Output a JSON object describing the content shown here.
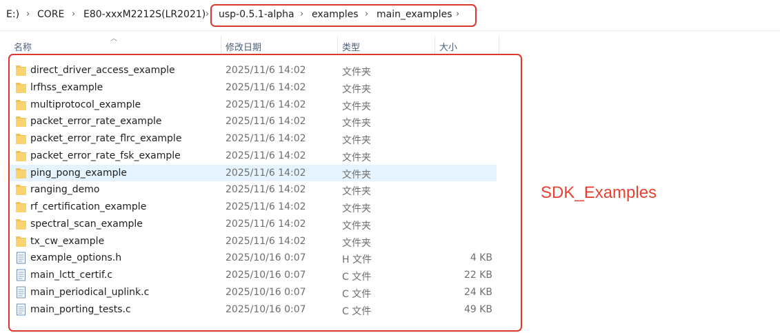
{
  "breadcrumb": {
    "drive": "E:)",
    "items": [
      "CORE",
      "E80-xxxM2212S(LR2021)",
      "usp-0.5.1-alpha",
      "examples",
      "main_examples"
    ]
  },
  "columns": {
    "name": "名称",
    "modified": "修改日期",
    "type": "类型",
    "size": "大小"
  },
  "files": [
    {
      "name": "direct_driver_access_example",
      "modified": "2025/11/6 14:02",
      "type": "文件夹",
      "size": "",
      "icon": "folder"
    },
    {
      "name": "lrfhss_example",
      "modified": "2025/11/6 14:02",
      "type": "文件夹",
      "size": "",
      "icon": "folder"
    },
    {
      "name": "multiprotocol_example",
      "modified": "2025/11/6 14:02",
      "type": "文件夹",
      "size": "",
      "icon": "folder"
    },
    {
      "name": "packet_error_rate_example",
      "modified": "2025/11/6 14:02",
      "type": "文件夹",
      "size": "",
      "icon": "folder"
    },
    {
      "name": "packet_error_rate_flrc_example",
      "modified": "2025/11/6 14:02",
      "type": "文件夹",
      "size": "",
      "icon": "folder"
    },
    {
      "name": "packet_error_rate_fsk_example",
      "modified": "2025/11/6 14:02",
      "type": "文件夹",
      "size": "",
      "icon": "folder"
    },
    {
      "name": "ping_pong_example",
      "modified": "2025/11/6 14:02",
      "type": "文件夹",
      "size": "",
      "icon": "folder",
      "selected": true
    },
    {
      "name": "ranging_demo",
      "modified": "2025/11/6 14:02",
      "type": "文件夹",
      "size": "",
      "icon": "folder"
    },
    {
      "name": "rf_certification_example",
      "modified": "2025/11/6 14:02",
      "type": "文件夹",
      "size": "",
      "icon": "folder"
    },
    {
      "name": "spectral_scan_example",
      "modified": "2025/11/6 14:02",
      "type": "文件夹",
      "size": "",
      "icon": "folder"
    },
    {
      "name": "tx_cw_example",
      "modified": "2025/11/6 14:02",
      "type": "文件夹",
      "size": "",
      "icon": "folder"
    },
    {
      "name": "example_options.h",
      "modified": "2025/10/16 0:07",
      "type": "H 文件",
      "size": "4 KB",
      "icon": "file"
    },
    {
      "name": "main_lctt_certif.c",
      "modified": "2025/10/16 0:07",
      "type": "C 文件",
      "size": "22 KB",
      "icon": "file"
    },
    {
      "name": "main_periodical_uplink.c",
      "modified": "2025/10/16 0:07",
      "type": "C 文件",
      "size": "24 KB",
      "icon": "file"
    },
    {
      "name": "main_porting_tests.c",
      "modified": "2025/10/16 0:07",
      "type": "C 文件",
      "size": "49 KB",
      "icon": "file"
    }
  ],
  "annotation": "SDK_Examples",
  "colors": {
    "highlight": "#d9382a",
    "annotation": "#e8412f",
    "selected_row": "#e5f3ff",
    "folder": "#f5c443"
  }
}
